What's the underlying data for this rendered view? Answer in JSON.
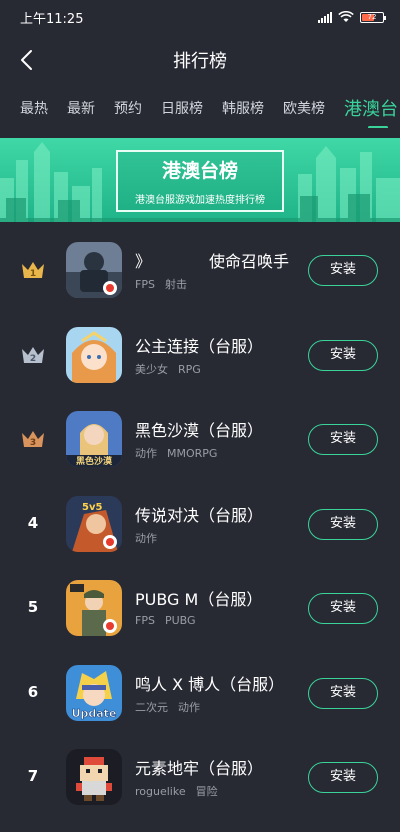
{
  "status_bar": {
    "time": "上午11:25",
    "battery": "72"
  },
  "header": {
    "title": "排行榜"
  },
  "tabs": [
    "最热",
    "最新",
    "预约",
    "日服榜",
    "韩服榜",
    "欧美榜",
    "港澳台"
  ],
  "banner": {
    "title": "港澳台榜",
    "subtitle": "港澳台服游戏加速热度排行榜"
  },
  "colors": {
    "accent": "#3ad49a",
    "background": "#272933",
    "banner": "#2fc597"
  },
  "apps": [
    {
      "rank": "1",
      "name": "使命召唤手",
      "name_prefix": "》",
      "tags": [
        "FPS",
        "射击"
      ],
      "install": "安装",
      "icon": "soldier-icon"
    },
    {
      "rank": "2",
      "name": "公主连接（台服）",
      "tags": [
        "美少女",
        "RPG"
      ],
      "install": "安装",
      "icon": "anime-girl-icon"
    },
    {
      "rank": "3",
      "name": "黑色沙漠（台服）",
      "tags": [
        "动作",
        "MMORPG"
      ],
      "install": "安装",
      "icon": "warrior-icon",
      "icon_text": "黑色沙漠"
    },
    {
      "rank": "4",
      "name": "传说对决（台服）",
      "tags": [
        "动作"
      ],
      "install": "安装",
      "icon": "hero-icon",
      "icon_text": "5v5"
    },
    {
      "rank": "5",
      "name": "PUBG M（台服）",
      "tags": [
        "FPS",
        "PUBG"
      ],
      "install": "安装",
      "icon": "pubg-icon"
    },
    {
      "rank": "6",
      "name": "鸣人 X 博人（台服）",
      "tags": [
        "二次元",
        "动作"
      ],
      "install": "安装",
      "icon": "ninja-icon",
      "icon_text": "Update"
    },
    {
      "rank": "7",
      "name": "元素地牢（台服）",
      "tags": [
        "roguelike",
        "冒险"
      ],
      "install": "安装",
      "icon": "pixel-knight-icon"
    }
  ]
}
